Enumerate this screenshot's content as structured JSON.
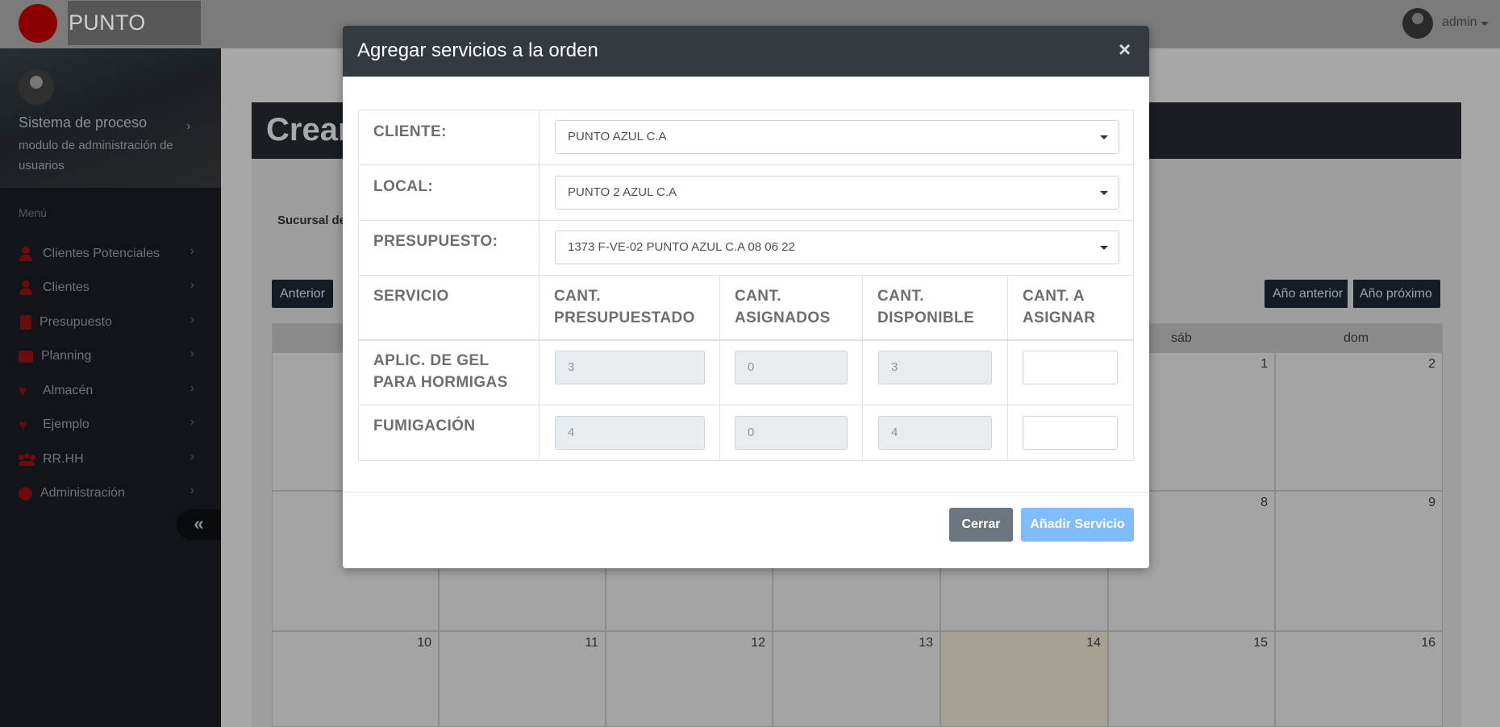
{
  "topbar": {
    "brand": "PUNTO ROJO",
    "user": "admin"
  },
  "sidebar": {
    "system_title": "Sistema de proceso",
    "system_subtitle": "modulo de administración de usuarios",
    "menu_label": "Menú",
    "items": [
      {
        "label": "Clientes Potenciales",
        "icon": "user-icon"
      },
      {
        "label": "Clientes",
        "icon": "user-icon"
      },
      {
        "label": "Presupuesto",
        "icon": "calculator-icon"
      },
      {
        "label": "Planning",
        "icon": "table-icon"
      },
      {
        "label": "Almacén",
        "icon": "heart-icon"
      },
      {
        "label": "Ejemplo",
        "icon": "heart-icon"
      },
      {
        "label": "RR.HH",
        "icon": "users-icon"
      },
      {
        "label": "Administración",
        "icon": "user-circle-icon"
      }
    ],
    "collapse_glyph": "«"
  },
  "page": {
    "title": "Crear",
    "sucursal_label": "Sucursal de",
    "prev_button": "Anterior",
    "prev_year_button": "Año anterior",
    "next_year_button": "Año próximo"
  },
  "calendar": {
    "weekday_headers": [
      "sáb",
      "dom"
    ],
    "week1": [
      "1",
      "2"
    ],
    "week2": [
      "8",
      "9"
    ],
    "week3": [
      "10",
      "11",
      "12",
      "13",
      "14",
      "15",
      "16"
    ]
  },
  "modal": {
    "title": "Agregar servicios a la orden",
    "close_glyph": "×",
    "cliente_label": "CLIENTE:",
    "cliente_value": "PUNTO AZUL C.A",
    "local_label": "LOCAL:",
    "local_value": "PUNTO 2 AZUL C.A",
    "presupuesto_label": "PRESUPUESTO:",
    "presupuesto_value": "1373 F-VE-02 PUNTO AZUL C.A 08 06 22",
    "columns": [
      "SERVICIO",
      "CANT. PRESUPUESTADO",
      "CANT. ASIGNADOS",
      "CANT. DISPONIBLE",
      "CANT. A ASIGNAR"
    ],
    "rows": [
      {
        "servicio": "APLIC. DE GEL PARA HORMIGAS",
        "presupuestado": "3",
        "asignados": "0",
        "disponible": "3",
        "asignar": ""
      },
      {
        "servicio": "FUMIGACIÓN",
        "presupuestado": "4",
        "asignados": "0",
        "disponible": "4",
        "asignar": ""
      }
    ],
    "close_button": "Cerrar",
    "add_button": "Añadir Servicio"
  }
}
